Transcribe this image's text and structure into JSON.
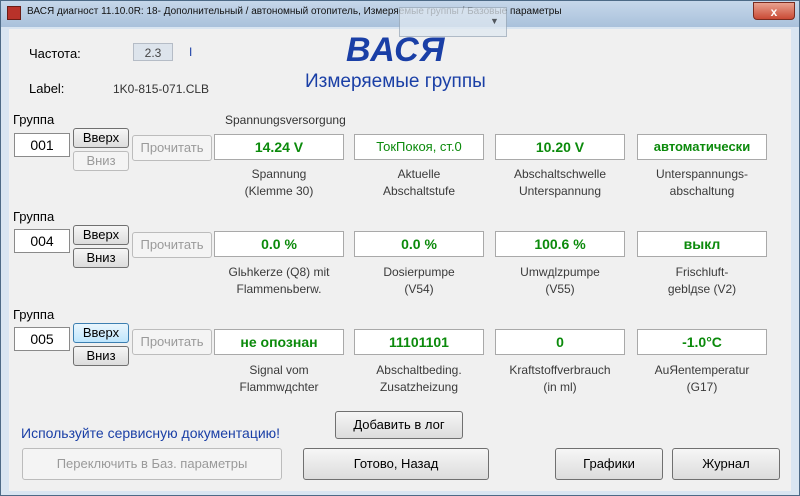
{
  "window": {
    "title": "ВАСЯ диагност 11.10.0R: 18- Дополнительный / автономный отопитель,  Измеряемые группы / Базовые параметры",
    "close_label": "x"
  },
  "header": {
    "freq_label": "Частота:",
    "freq_value": "2.3",
    "freq_unit": "I",
    "label_label": "Label:",
    "label_value": "1K0-815-071.CLB",
    "brand": "ВАСЯ",
    "subtitle": "Измеряемые группы"
  },
  "groups": [
    {
      "label": "Группа",
      "number": "001",
      "up": "Вверх",
      "down": "Вниз",
      "read": "Прочитать",
      "heading": "Spannungsversorgung",
      "fields": [
        {
          "value": "14.24 V",
          "caption1": "Spannung",
          "caption2": "(Klemme 30)"
        },
        {
          "value": "ТокПокоя, ст.0",
          "caption1": "Aktuelle",
          "caption2": "Abschaltstufe"
        },
        {
          "value": "10.20 V",
          "caption1": "Abschaltschwelle",
          "caption2": "Unterspannung"
        },
        {
          "value": "автоматически",
          "caption1": "Unterspannungs-",
          "caption2": "abschaltung"
        }
      ]
    },
    {
      "label": "Группа",
      "number": "004",
      "up": "Вверх",
      "down": "Вниз",
      "read": "Прочитать",
      "fields": [
        {
          "value": "0.0 %",
          "caption1": "Glьhkerze (Q8) mit",
          "caption2": "Flammenьberw."
        },
        {
          "value": "0.0 %",
          "caption1": "Dosierpumpe",
          "caption2": "(V54)"
        },
        {
          "value": "100.6 %",
          "caption1": "Umwдlzpumpe",
          "caption2": "(V55)"
        },
        {
          "value": "выкл",
          "caption1": "Frischluft-",
          "caption2": "geblдse (V2)"
        }
      ]
    },
    {
      "label": "Группа",
      "number": "005",
      "up": "Вверх",
      "down": "Вниз",
      "read": "Прочитать",
      "fields": [
        {
          "value": "не опознан",
          "caption1": "Signal vom",
          "caption2": "Flammwдchter"
        },
        {
          "value": "11101101",
          "caption1": "Abschaltbeding.",
          "caption2": "Zusatzheizung"
        },
        {
          "value": "0",
          "caption1": "Kraftstoffverbrauch",
          "caption2": "(in ml)"
        },
        {
          "value": "-1.0°C",
          "caption1": "AuЯentemperatur",
          "caption2": "(G17)"
        }
      ]
    }
  ],
  "footer": {
    "note": "Используйте сервисную документацию!",
    "add_log": "Добавить в лог",
    "switch_basic": "Переключить в Баз. параметры",
    "done_back": "Готово, Назад",
    "graphs": "Графики",
    "journal": "Журнал"
  }
}
